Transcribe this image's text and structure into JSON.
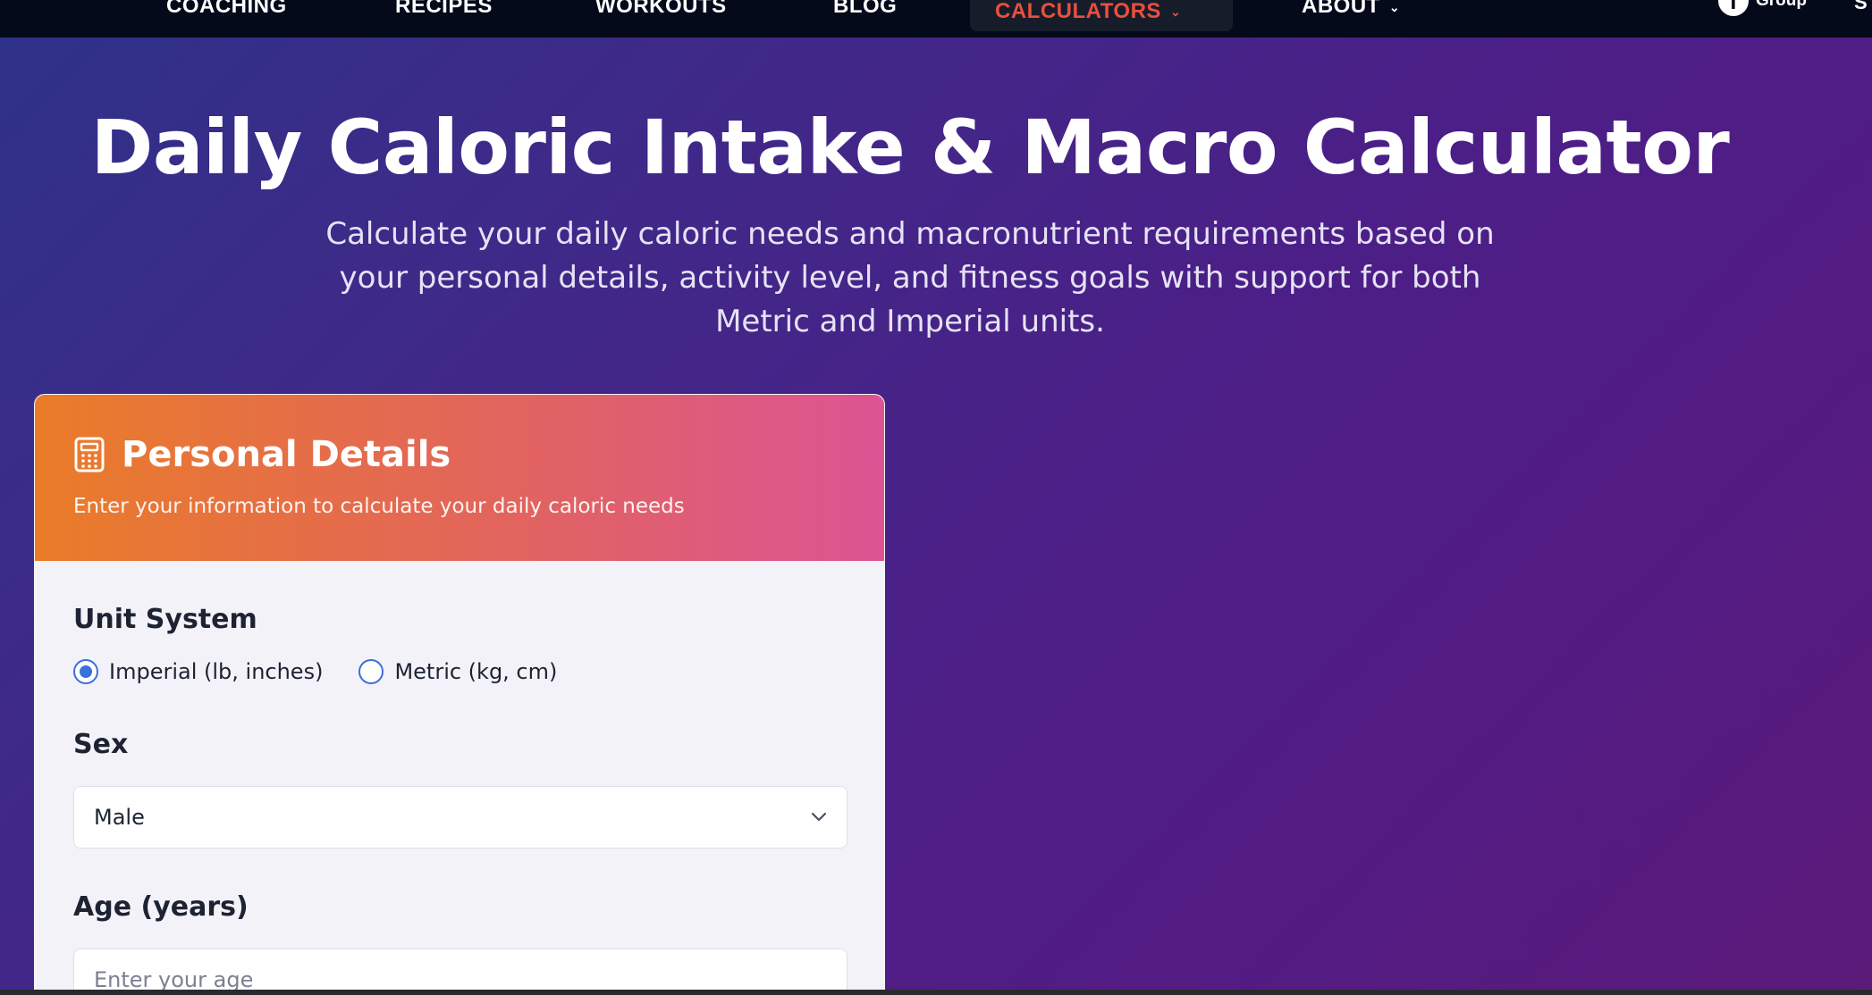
{
  "nav": {
    "items": [
      {
        "label": "COACHING",
        "dropdown": false,
        "active": false
      },
      {
        "label": "RECIPES",
        "dropdown": false,
        "active": false
      },
      {
        "label": "WORKOUTS",
        "dropdown": false,
        "active": false
      },
      {
        "label": "BLOG",
        "dropdown": false,
        "active": false
      },
      {
        "label": "CALCULATORS",
        "dropdown": true,
        "active": true
      },
      {
        "label": "ABOUT",
        "dropdown": true,
        "active": false
      }
    ],
    "facebook_label": "Group",
    "cut_label": "S",
    "active_color": "#e8503c"
  },
  "hero": {
    "title": "Daily Caloric Intake & Macro Calculator",
    "subtitle": "Calculate your daily caloric needs and macronutrient requirements based on your personal details, activity level, and fitness goals with support for both Metric and Imperial units."
  },
  "card": {
    "title": "Personal Details",
    "description": "Enter your information to calculate your daily caloric needs",
    "unit_system": {
      "label": "Unit System",
      "options": [
        {
          "label": "Imperial (lb, inches)",
          "checked": true
        },
        {
          "label": "Metric (kg, cm)",
          "checked": false
        }
      ]
    },
    "sex": {
      "label": "Sex",
      "selected": "Male"
    },
    "age": {
      "label": "Age (years)",
      "placeholder": "Enter your age"
    }
  },
  "colors": {
    "header_gradient_start": "#ea7c28",
    "header_gradient_end": "#dc5494",
    "radio_accent": "#3b6fd9"
  }
}
